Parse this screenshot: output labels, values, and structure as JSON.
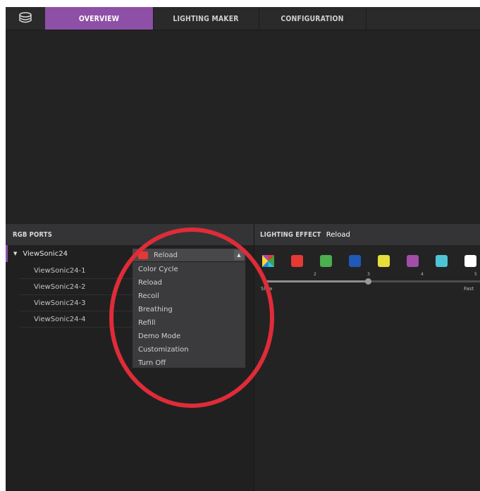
{
  "nav": {
    "tabs": [
      {
        "label": "OVERVIEW"
      },
      {
        "label": "LIGHTING MAKER"
      },
      {
        "label": "CONFIGURATION"
      }
    ],
    "active_tab": "OVERVIEW"
  },
  "rgb_ports": {
    "header": "RGB PORTS",
    "parent": "ViewSonic24",
    "children": [
      "ViewSonic24-1",
      "ViewSonic24-2",
      "ViewSonic24-3",
      "ViewSonic24-4"
    ]
  },
  "dropdown": {
    "selected": "Reload",
    "options": [
      "Color Cycle",
      "Reload",
      "Recoil",
      "Breathing",
      "Refill",
      "Demo Mode",
      "Customization",
      "Turn Off"
    ]
  },
  "lighting_effect": {
    "header_label": "LIGHTING EFFECT",
    "current": "Reload",
    "colors": [
      "#e53935",
      "#4caf50",
      "#1e5bb8",
      "#e6df3a",
      "#a24ea8",
      "#4fc3d6",
      "#ffffff"
    ],
    "speed": {
      "ticks": [
        "2",
        "3",
        "4",
        "5"
      ],
      "value": 3,
      "min_label": "Slow",
      "max_label": "Fast"
    }
  },
  "theme": {
    "accent": "#8e4fa6",
    "annotation": "#df2c38"
  }
}
